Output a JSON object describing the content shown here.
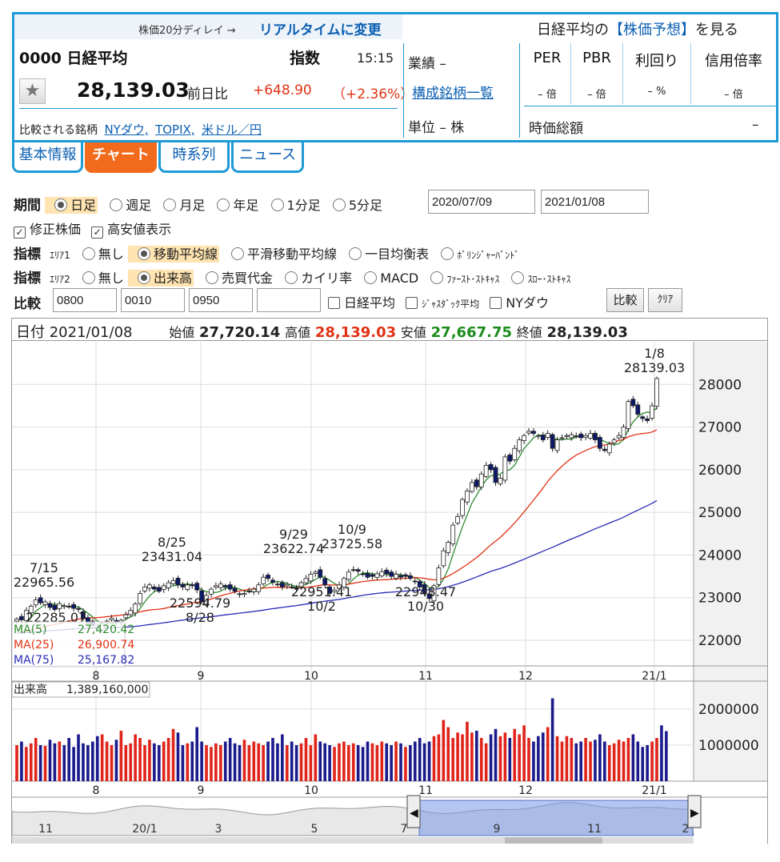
{
  "header": {
    "delay_text": "株価20分ディレイ →",
    "realtime_link": "リアルタイムに変更",
    "predict_prefix": "日経平均の",
    "predict_link": "【株価予想】",
    "predict_suffix": "を見る",
    "code_name": "0000 日経平均",
    "kind": "指数",
    "time": "15:15",
    "price": "28,139.03",
    "compare_label": "前日比",
    "change": "+648.90",
    "change_pct_open": "（",
    "change_pct": "+2.36%",
    "change_pct_close": "）",
    "compare_prefix": "比較される銘柄",
    "compare_links": [
      "NYダウ,",
      "TOPIX,",
      "米ドル／円"
    ],
    "gyoseki": "業績 –",
    "kousei_link": "構成銘柄一覧",
    "tani": "単位 – 株",
    "metrics": [
      {
        "label": "PER",
        "value": "– 倍"
      },
      {
        "label": "PBR",
        "value": "– 倍"
      },
      {
        "label": "利回り",
        "value": "– %"
      },
      {
        "label": "信用倍率",
        "value": "– 倍"
      }
    ],
    "market_cap_label": "時価総額",
    "market_cap_value": "–"
  },
  "tabs": [
    {
      "label": "基本情報",
      "active": false
    },
    {
      "label": "チャート",
      "active": true
    },
    {
      "label": "時系列",
      "active": false
    },
    {
      "label": "ニュース",
      "active": false
    }
  ],
  "controls": {
    "period_label": "期間",
    "period_options": [
      "日足",
      "週足",
      "月足",
      "年足",
      "1分足",
      "5分足"
    ],
    "period_selected": "日足",
    "date_from": "2020/07/09",
    "date_to": "2021/01/08",
    "checks": [
      {
        "label": "修正株価",
        "checked": true
      },
      {
        "label": "高安値表示",
        "checked": true
      }
    ],
    "ind1_label": "指標",
    "ind1_area": "ｴﾘｱ1",
    "ind1_options": [
      "無し",
      "移動平均線",
      "平滑移動平均線",
      "一目均衡表",
      "ﾎﾞﾘﾝｼﾞｬｰﾊﾞﾝﾄﾞ"
    ],
    "ind1_selected": "移動平均線",
    "ind2_label": "指標",
    "ind2_area": "ｴﾘｱ2",
    "ind2_options": [
      "無し",
      "出来高",
      "売買代金",
      "カイリ率",
      "MACD",
      "ﾌｧｰｽﾄ･ｽﾄｷｬｽ",
      "ｽﾛｰ･ｽﾄｷｬｽ"
    ],
    "ind2_selected": "出来高",
    "cmp_label": "比較",
    "cmp_inputs": [
      "0800",
      "0010",
      "0950",
      ""
    ],
    "cmp_checks": [
      "日経平均",
      "ｼﾞｬｽﾀﾞｯｸ平均",
      "NYダウ"
    ],
    "cmp_button": "比較",
    "clear_button": "ｸﾘｱ"
  },
  "infobar": {
    "date_label": "日付",
    "date": "2021/01/08",
    "open_label": "始値",
    "open": "27,720.14",
    "high_label": "高値",
    "high": "28,139.03",
    "low_label": "安値",
    "low": "27,667.75",
    "close_label": "終値",
    "close": "28,139.03"
  },
  "chart_data": [
    {
      "type": "candlestick",
      "y_ticks": [
        22000,
        23000,
        24000,
        25000,
        26000,
        27000,
        28000
      ],
      "ylim": [
        21400,
        29000
      ],
      "x_labels": [
        "8",
        "9",
        "10",
        "11",
        "12",
        "21/1"
      ],
      "annotations": [
        {
          "text": "7/15",
          "sub": "22965.56"
        },
        {
          "text": "8/25",
          "sub": "23431.04"
        },
        {
          "text": "9/29",
          "sub": "23622.74"
        },
        {
          "text": "10/9",
          "sub": "23725.58"
        },
        {
          "text": "22594.79",
          "sub": "8/28"
        },
        {
          "text": "22951.41",
          "sub": "10/2"
        },
        {
          "text": "22948.47",
          "sub": "10/30"
        },
        {
          "text": "1/8",
          "sub": "28139.03"
        },
        {
          "text": "22285.07",
          "sub": ""
        }
      ],
      "legend": [
        {
          "name": "MA(5)",
          "value": "27,420.42",
          "color": "#2e8b2e"
        },
        {
          "name": "MA(25)",
          "value": "26,900.74",
          "color": "#e03214"
        },
        {
          "name": "MA(75)",
          "value": "25,167.82",
          "color": "#2a2ab8"
        }
      ],
      "close": [
        22500,
        22480,
        22700,
        22800,
        22950,
        22880,
        22900,
        22770,
        22720,
        22860,
        22810,
        22780,
        22750,
        22730,
        22510,
        22400,
        22350,
        22300,
        22380,
        22450,
        22520,
        22430,
        22470,
        22600,
        22700,
        22850,
        23100,
        23250,
        23300,
        23200,
        23150,
        23280,
        23350,
        23400,
        23300,
        23250,
        23300,
        23280,
        23180,
        22900,
        23050,
        23200,
        23280,
        23320,
        23250,
        23200,
        23150,
        23080,
        23100,
        23150,
        23200,
        23300,
        23480,
        23450,
        23360,
        23300,
        23250,
        23310,
        23250,
        23200,
        23350,
        23450,
        23550,
        23600,
        23480,
        23300,
        23100,
        23180,
        23300,
        23450,
        23600,
        23650,
        23620,
        23560,
        23480,
        23500,
        23560,
        23610,
        23560,
        23500,
        23550,
        23480,
        23500,
        23450,
        23380,
        23250,
        23100,
        22980,
        23280,
        23700,
        24100,
        24300,
        24700,
        24900,
        25300,
        25500,
        25700,
        25600,
        25900,
        26100,
        26000,
        25700,
        25800,
        26300,
        26200,
        26500,
        26700,
        26800,
        26900,
        26850,
        26800,
        26700,
        26850,
        26500,
        26700,
        26750,
        26800,
        26820,
        26780,
        26750,
        26800,
        26850,
        26700,
        26500,
        26450,
        26600,
        26700,
        26800,
        27000,
        27600,
        27500,
        27300,
        27200,
        27150,
        27500,
        28139
      ],
      "ma5": [],
      "ma25": [],
      "ma75": [],
      "volume_label": "出来高",
      "volume_value": "1,389,160,000",
      "volume_ticks": [
        1000000,
        2000000
      ],
      "volume": [
        1000000,
        1100000,
        950000,
        1050000,
        1200000,
        1000000,
        980000,
        1150000,
        1050000,
        1100000,
        1000000,
        1200000,
        950000,
        1300000,
        1050000,
        1000000,
        1100000,
        1250000,
        1300000,
        1100000,
        1000000,
        1150000,
        1400000,
        1000000,
        1050000,
        1300000,
        1200000,
        1000000,
        1150000,
        1050000,
        1000000,
        1100000,
        1200000,
        1450000,
        1350000,
        1000000,
        1050000,
        1100000,
        1500000,
        1100000,
        1000000,
        950000,
        1050000,
        1000000,
        1100000,
        1200000,
        1050000,
        1000000,
        1150000,
        1000000,
        1100000,
        1050000,
        1000000,
        1100000,
        1200000,
        1050000,
        1300000,
        1000000,
        1100000,
        1000000,
        1050000,
        1200000,
        1000000,
        1300000,
        1100000,
        1050000,
        1000000,
        950000,
        1050000,
        1100000,
        1000000,
        1050000,
        1000000,
        950000,
        1100000,
        1050000,
        1000000,
        1100000,
        1050000,
        1000000,
        1100000,
        1050000,
        950000,
        1000000,
        1100000,
        1200000,
        1050000,
        1100000,
        1250000,
        1300000,
        1700000,
        1500000,
        1200000,
        1350000,
        1300000,
        1650000,
        1350000,
        1400000,
        1200000,
        1050000,
        1300000,
        1450000,
        1250000,
        1350000,
        1200000,
        1450000,
        1300000,
        1550000,
        1200000,
        1100000,
        1250000,
        1350000,
        1500000,
        2300000,
        1250000,
        1100000,
        1250000,
        1200000,
        1050000,
        1100000,
        1200000,
        1100000,
        1150000,
        1300000,
        1100000,
        1000000,
        1050000,
        1150000,
        1100000,
        1200000,
        1300000,
        1100000,
        950000,
        1000000,
        1100000,
        1200000,
        1550000,
        1389160
      ],
      "volume_up": []
    }
  ],
  "navigator": {
    "labels": [
      "11",
      "20/1",
      "3",
      "5",
      "7",
      "9",
      "11",
      "2"
    ]
  }
}
